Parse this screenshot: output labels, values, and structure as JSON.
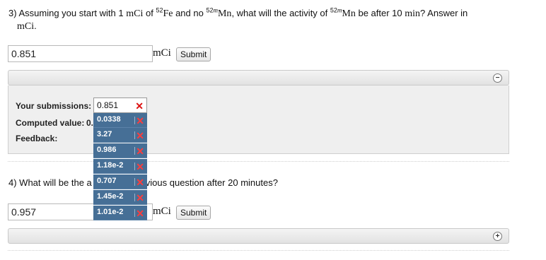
{
  "q3": {
    "num": "3)",
    "t1": "Assuming you start with 1",
    "m1": "mCi",
    "t2": "of",
    "sup1": "52",
    "el1": "Fe",
    "t3": "and no",
    "sup2": "52",
    "sup2m": "m",
    "el2": "Mn",
    "t4": ", what will the activity of",
    "sup3": "52",
    "sup3m": "m",
    "el3": "Mn",
    "t5": "be after 10",
    "m2": "min",
    "t6": "? Answer in",
    "m3": "mCi",
    "t7": ".",
    "answer_value": "0.851",
    "unit": "mCi",
    "submit": "Submit"
  },
  "feedback": {
    "submissions_label": "Your submissions:",
    "computed_label": "Computed value:",
    "computed_partial": "0.",
    "feedback_label": "Feedback:",
    "selected_submission": "0.851",
    "x_mark": "✕",
    "submissions": [
      "0.0338",
      "3.27",
      "0.986",
      "1.18e-2",
      "0.707",
      "1.45e-2",
      "1.01e-2"
    ],
    "collapse_icon": "minus-circle-icon",
    "expand_icon": "plus-circle-icon"
  },
  "q4": {
    "prefix": "4) What will be the a",
    "suffix": "vious question after 20 minutes?",
    "answer_value": "0.957",
    "unit": "mCi",
    "submit": "Submit"
  }
}
